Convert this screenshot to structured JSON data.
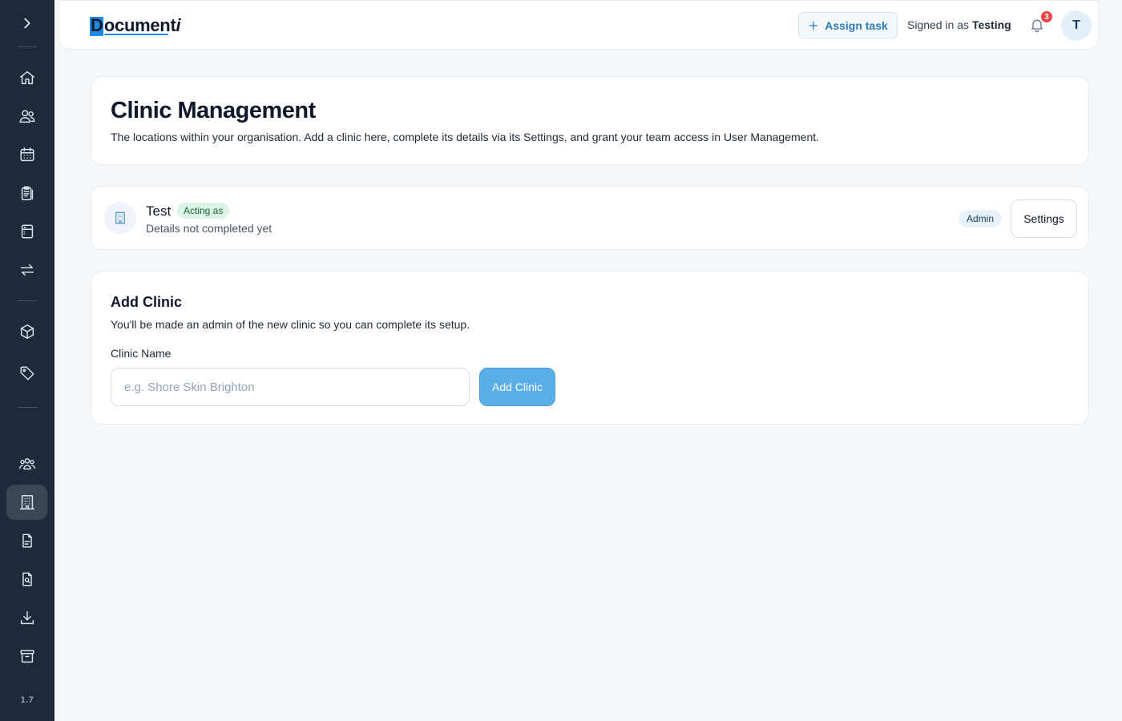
{
  "sidebar": {
    "items": [
      {
        "name": "sidebar-item-home",
        "icon": "home-icon"
      },
      {
        "name": "sidebar-item-patients",
        "icon": "users-icon"
      },
      {
        "name": "sidebar-item-calendar",
        "icon": "calendar-icon"
      },
      {
        "name": "sidebar-item-forms",
        "icon": "clipboard-icon"
      },
      {
        "name": "sidebar-item-templates",
        "icon": "layout-icon"
      },
      {
        "name": "sidebar-item-transfers",
        "icon": "arrows-exchange-icon"
      },
      {
        "name": "sidebar-item-products",
        "icon": "box-icon"
      },
      {
        "name": "sidebar-item-tags",
        "icon": "tag-icon"
      },
      {
        "name": "sidebar-item-users",
        "icon": "team-icon"
      },
      {
        "name": "sidebar-item-clinics",
        "icon": "building-icon",
        "active": true
      },
      {
        "name": "sidebar-item-documents",
        "icon": "file-text-icon"
      },
      {
        "name": "sidebar-item-search-documents",
        "icon": "file-search-icon"
      },
      {
        "name": "sidebar-item-downloads",
        "icon": "download-icon"
      },
      {
        "name": "sidebar-item-archive",
        "icon": "archive-icon"
      }
    ],
    "version": "1.7"
  },
  "header": {
    "logo_first": "D",
    "logo_rest": "ocument",
    "logo_last": "i",
    "assign_task_label": "Assign task",
    "signed_in_prefix": "Signed in as",
    "signed_in_user": "Testing",
    "notification_count": "3",
    "avatar_initial": "T"
  },
  "page": {
    "title": "Clinic Management",
    "description": "The locations within your organisation. Add a clinic here, complete its details via its Settings, and grant your team access in User Management."
  },
  "clinics": [
    {
      "name": "Test",
      "acting_badge": "Acting as",
      "status": "Details not completed yet",
      "role": "Admin",
      "settings_label": "Settings"
    }
  ],
  "add_clinic": {
    "title": "Add Clinic",
    "description": "You'll be made an admin of the new clinic so you can complete its setup.",
    "field_label": "Clinic Name",
    "placeholder": "e.g. Shore Skin Brighton",
    "value": "",
    "button_label": "Add Clinic"
  },
  "colors": {
    "sidebar_bg": "#1e293b",
    "accent": "#5aaee8",
    "badge_red": "#ef4444",
    "acting_green": "#dcf5e6"
  }
}
